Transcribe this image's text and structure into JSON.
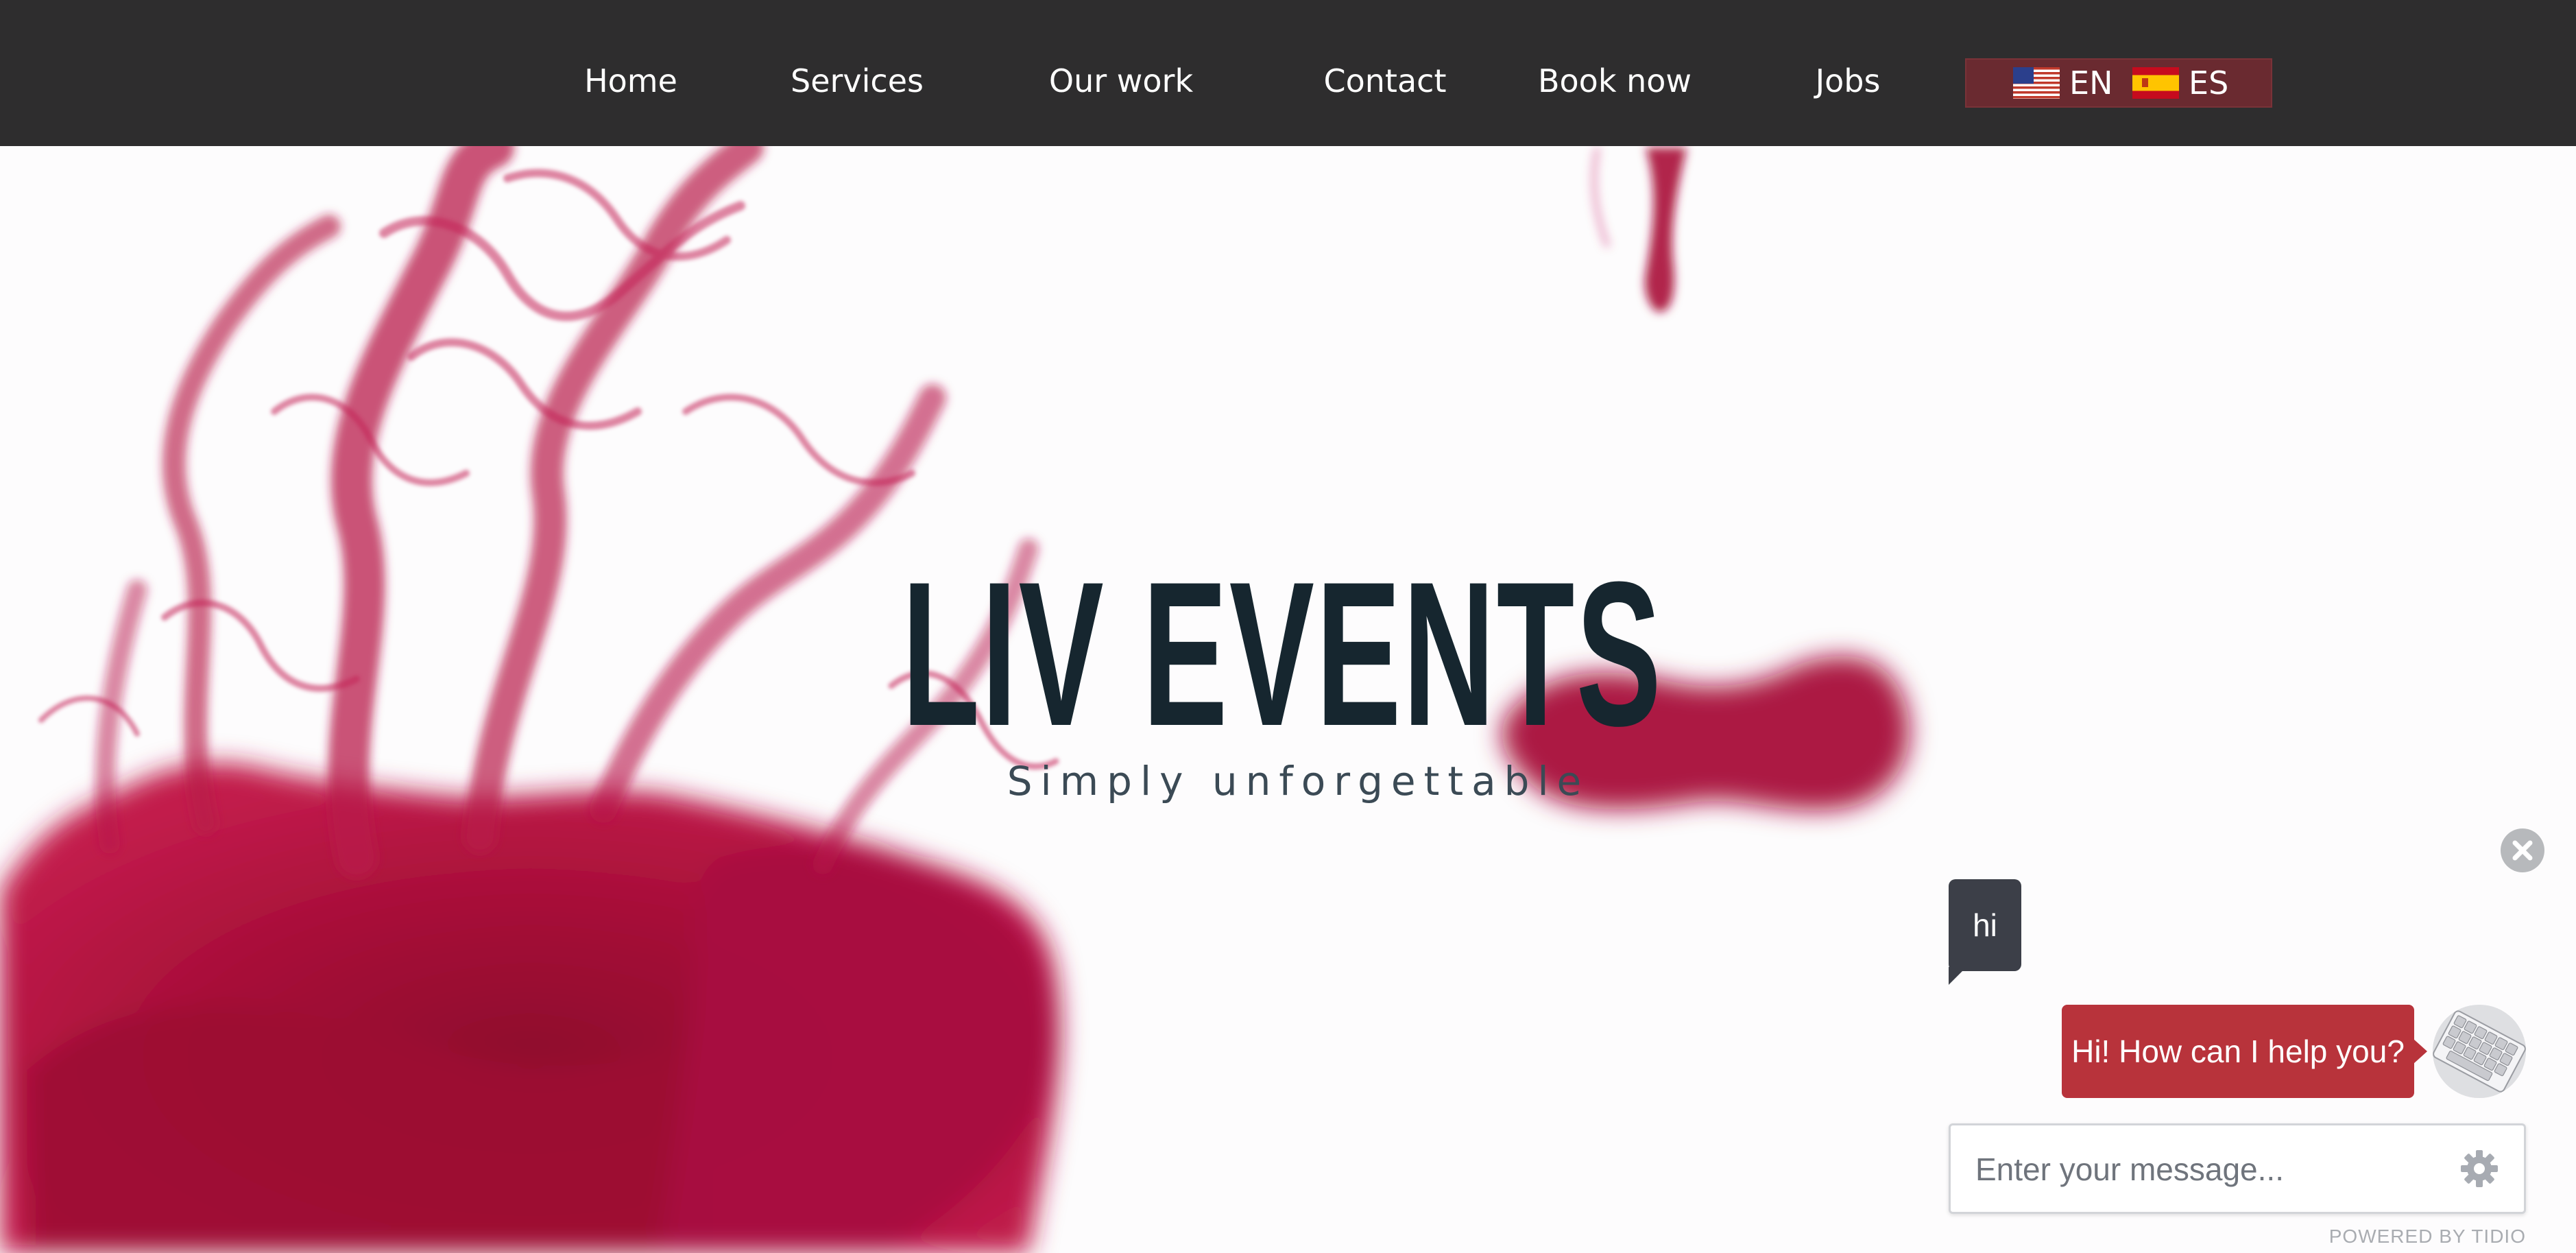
{
  "nav": {
    "items": [
      {
        "label": "Home"
      },
      {
        "label": "Services"
      },
      {
        "label": "Our work"
      },
      {
        "label": "Contact"
      },
      {
        "label": "Book now"
      },
      {
        "label": "Jobs"
      }
    ],
    "languages": [
      {
        "code": "EN",
        "flag_icon": "us-flag-icon"
      },
      {
        "code": "ES",
        "flag_icon": "spain-flag-icon"
      }
    ],
    "bar_color": "#2e2d2e",
    "lang_switcher_color": "#6a2a30"
  },
  "hero": {
    "title": "LIV EVENTS",
    "tagline": "Simply unforgettable",
    "background_image": "crimson ink clouds in water",
    "ink_color": "#b0123e",
    "title_color": "#16262f"
  },
  "chat": {
    "close_icon": "close-icon",
    "user_message": "hi",
    "agent_message": "Hi! How can I help you?",
    "agent_avatar": "keyboard-avatar",
    "input_placeholder": "Enter your message...",
    "settings_icon": "gear-icon",
    "powered_by": "POWERED BY TIDIO",
    "agent_bubble_color": "#b8333b",
    "user_bubble_color": "#3c3f48"
  }
}
